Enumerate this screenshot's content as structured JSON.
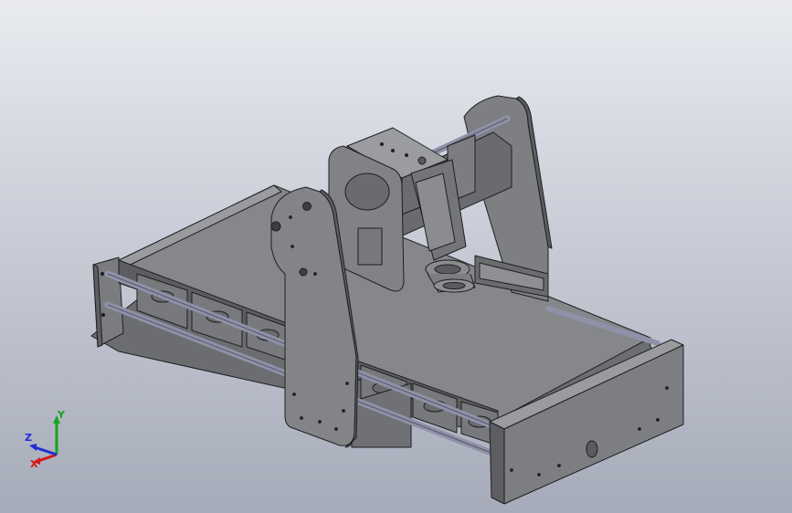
{
  "viewport": {
    "background_top": "#e9ebf0",
    "background_bottom": "#a6abb9"
  },
  "model": {
    "part_color": "#838385",
    "part_dark": "#5e5f62",
    "part_light": "#9d9ea1",
    "edge_color": "#1f1f22",
    "rod_color": "#8f91a8"
  },
  "triad": {
    "x_label": "X",
    "y_label": "Y",
    "z_label": "Z",
    "x_color": "#d21a1a",
    "y_color": "#13a61d",
    "z_color": "#1f2fd6"
  }
}
